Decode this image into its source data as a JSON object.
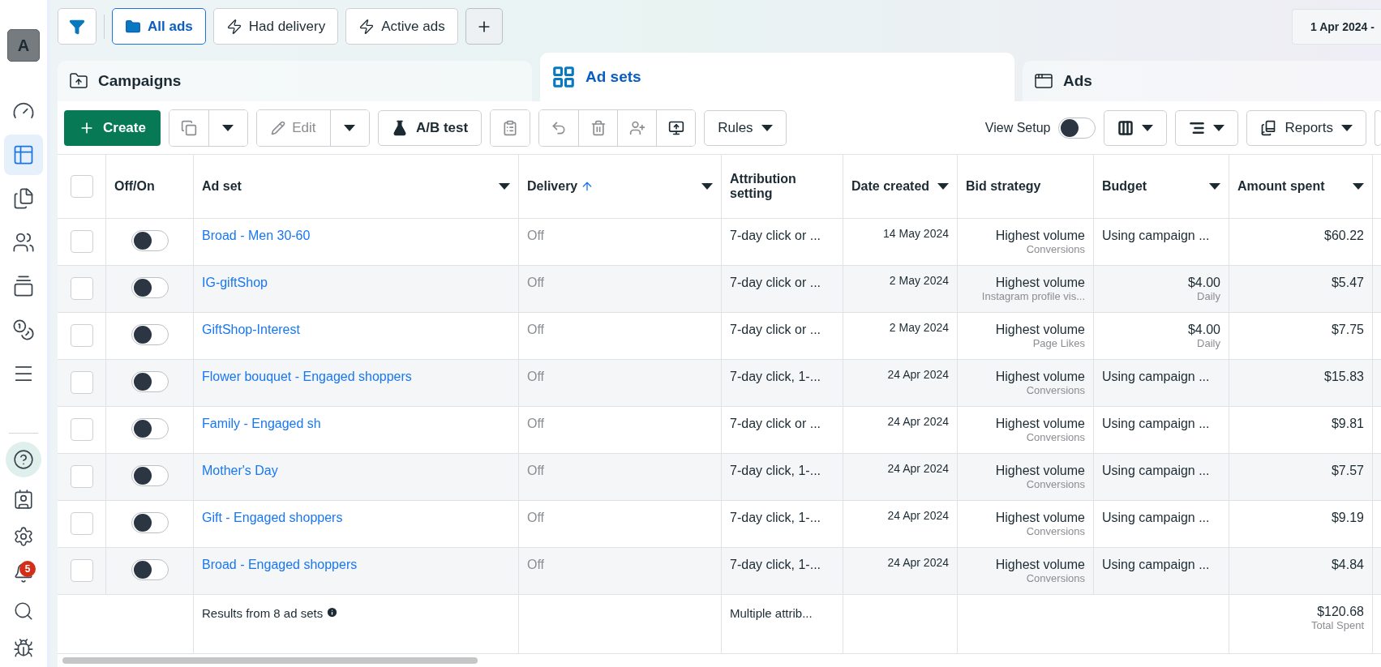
{
  "sidebar": {
    "avatar": "A",
    "items": [
      {
        "selected": false
      },
      {
        "selected": true
      },
      {
        "selected": false
      },
      {
        "selected": false
      },
      {
        "selected": false
      },
      {
        "selected": false
      },
      {
        "selected": false
      }
    ],
    "bottom_items": [
      {
        "selected": true
      },
      {
        "selected": false
      },
      {
        "selected": false
      },
      {
        "selected": false
      },
      {
        "selected": false
      },
      {
        "selected": false
      }
    ],
    "notification_count": "5"
  },
  "view_buttons": [
    {
      "label": "All ads",
      "selected": true
    },
    {
      "label": "Had delivery",
      "selected": false
    },
    {
      "label": "Active ads",
      "selected": false
    }
  ],
  "date_range": "1 Apr 2024 -",
  "level_tabs": [
    {
      "label": "Campaigns",
      "selected": false
    },
    {
      "label": "Ad sets",
      "selected": true
    },
    {
      "label": "Ads",
      "selected": false
    }
  ],
  "toolbar": {
    "create": "Create",
    "edit": "Edit",
    "ab_test": "A/B test",
    "rules": "Rules",
    "view_setup": {
      "label": "View Setup",
      "on": false
    },
    "reports": "Reports"
  },
  "table": {
    "select_all": {
      "checked": false
    },
    "columns": [
      {
        "label": "Off/On",
        "menu": false,
        "sorted": false
      },
      {
        "label": "Ad set",
        "menu": true,
        "sorted": false
      },
      {
        "label": "Delivery",
        "menu": true,
        "sorted": true
      },
      {
        "label": "Attribution setting",
        "menu": false,
        "sorted": false
      },
      {
        "label": "Date created",
        "menu": true,
        "sorted": false
      },
      {
        "label": "Bid strategy",
        "menu": false,
        "sorted": false
      },
      {
        "label": "Budget",
        "menu": true,
        "sorted": false
      },
      {
        "label": "Amount spent",
        "menu": true,
        "sorted": false
      }
    ],
    "rows": [
      {
        "checked": false,
        "on": false,
        "name": "Broad - Men 30-60",
        "delivery": "Off",
        "attribution": "7-day click or ...",
        "date": "14 May 2024",
        "bid": "Highest volume",
        "bid_detail": "Conversions",
        "budget": "Using campaign ...",
        "spent": "$60.22"
      },
      {
        "checked": false,
        "on": false,
        "name": "IG-giftShop",
        "delivery": "Off",
        "attribution": "7-day click or ...",
        "date": "2 May 2024",
        "bid": "Highest volume",
        "bid_detail": "Instagram profile vis...",
        "budget": "$4.00",
        "budget_detail": "Daily",
        "spent": "$5.47"
      },
      {
        "checked": false,
        "on": false,
        "name": "GiftShop-Interest",
        "delivery": "Off",
        "attribution": "7-day click or ...",
        "date": "2 May 2024",
        "bid": "Highest volume",
        "bid_detail": "Page Likes",
        "budget": "$4.00",
        "budget_detail": "Daily",
        "spent": "$7.75"
      },
      {
        "checked": false,
        "on": false,
        "name": "Flower bouquet - Engaged shoppers",
        "delivery": "Off",
        "attribution": "7-day click, 1-...",
        "date": "24 Apr 2024",
        "bid": "Highest volume",
        "bid_detail": "Conversions",
        "budget": "Using campaign ...",
        "spent": "$15.83"
      },
      {
        "checked": false,
        "on": false,
        "name": "Family - Engaged sh",
        "delivery": "Off",
        "attribution": "7-day click or ...",
        "date": "24 Apr 2024",
        "bid": "Highest volume",
        "bid_detail": "Conversions",
        "budget": "Using campaign ...",
        "spent": "$9.81"
      },
      {
        "checked": false,
        "on": false,
        "name": "Mother's Day",
        "delivery": "Off",
        "attribution": "7-day click, 1-...",
        "date": "24 Apr 2024",
        "bid": "Highest volume",
        "bid_detail": "Conversions",
        "budget": "Using campaign ...",
        "spent": "$7.57"
      },
      {
        "checked": false,
        "on": false,
        "name": "Gift - Engaged shoppers",
        "delivery": "Off",
        "attribution": "7-day click, 1-...",
        "date": "24 Apr 2024",
        "bid": "Highest volume",
        "bid_detail": "Conversions",
        "budget": "Using campaign ...",
        "spent": "$9.19"
      },
      {
        "checked": false,
        "on": false,
        "name": "Broad - Engaged shoppers",
        "delivery": "Off",
        "attribution": "7-day click, 1-...",
        "date": "24 Apr 2024",
        "bid": "Highest volume",
        "bid_detail": "Conversions",
        "budget": "Using campaign ...",
        "spent": "$4.84"
      }
    ],
    "footer": {
      "results": "Results from 8 ad sets",
      "attribution": "Multiple attrib...",
      "spent": "$120.68",
      "spent_label": "Total Spent"
    }
  }
}
